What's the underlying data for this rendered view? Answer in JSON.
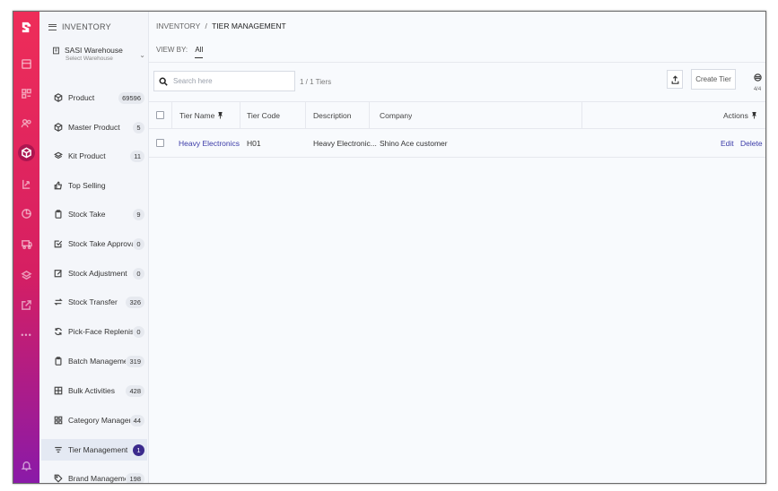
{
  "sidebar": {
    "title": "INVENTORY",
    "warehouse": {
      "name": "SASI Warehouse",
      "sub": "Select Warehouse"
    },
    "items": [
      {
        "label": "Product",
        "badge": "69596",
        "icon": "cube-icon"
      },
      {
        "label": "Master Product",
        "badge": "5",
        "icon": "cube-icon"
      },
      {
        "label": "Kit Product",
        "badge": "11",
        "icon": "layers-icon"
      },
      {
        "label": "Top Selling",
        "badge": "",
        "icon": "thumbs-up-icon"
      },
      {
        "label": "Stock Take",
        "badge": "9",
        "icon": "clipboard-icon"
      },
      {
        "label": "Stock Take Approval",
        "badge": "0",
        "icon": "checkbox-icon"
      },
      {
        "label": "Stock Adjustment",
        "badge": "0",
        "icon": "edit-icon"
      },
      {
        "label": "Stock Transfer",
        "badge": "326",
        "icon": "transfer-icon"
      },
      {
        "label": "Pick-Face Replenish...",
        "badge": "0",
        "icon": "refresh-icon"
      },
      {
        "label": "Batch Management",
        "badge": "319",
        "icon": "clipboard-icon"
      },
      {
        "label": "Bulk Activities",
        "badge": "428",
        "icon": "grid-icon"
      },
      {
        "label": "Category Managem...",
        "badge": "44",
        "icon": "category-icon"
      },
      {
        "label": "Tier Management",
        "badge": "1",
        "icon": "filter-icon"
      },
      {
        "label": "Brand Management",
        "badge": "198",
        "icon": "tag-icon"
      }
    ]
  },
  "breadcrumb": {
    "parent": "INVENTORY",
    "separator": "/",
    "current": "TIER MANAGEMENT"
  },
  "viewby": {
    "label": "VIEW BY:",
    "value": "All"
  },
  "search": {
    "placeholder": "Search here"
  },
  "count_text": "1 / 1 Tiers",
  "create_label": "Create Tier",
  "column_count": "4/4",
  "table": {
    "headers": {
      "name": "Tier Name",
      "code": "Tier Code",
      "description": "Description",
      "company": "Company",
      "actions": "Actions"
    },
    "rows": [
      {
        "name": "Heavy Electronics",
        "code": "H01",
        "description": "Heavy Electronic...",
        "company": "Shino Ace customer",
        "edit": "Edit",
        "delete": "Delete"
      }
    ]
  },
  "colors": {
    "rail_top": "#ee2d59",
    "rail_bottom": "#8a1aa8",
    "active_badge": "#3b2a8c",
    "link": "#3b3ba8"
  }
}
